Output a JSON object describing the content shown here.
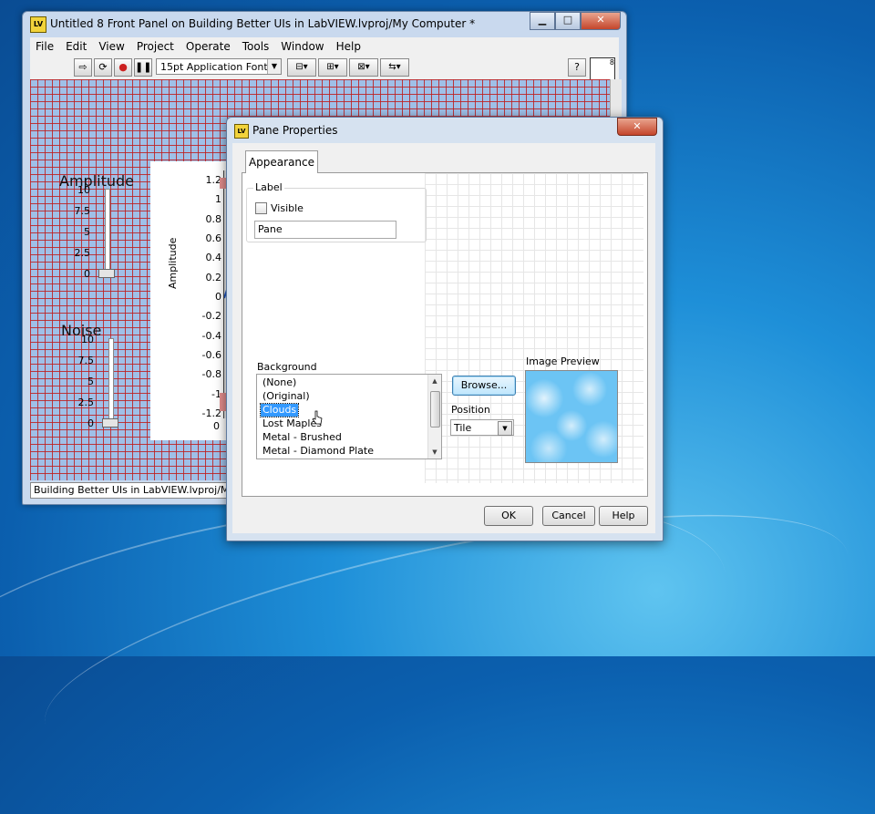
{
  "lv_window": {
    "title": "Untitled 8 Front Panel on Building Better UIs in LabVIEW.lvproj/My Computer *",
    "menu": [
      "File",
      "Edit",
      "View",
      "Project",
      "Operate",
      "Tools",
      "Window",
      "Help"
    ],
    "font_select": "15pt Application Font",
    "status_bar": "Building Better UIs in LabVIEW.lvproj/My C",
    "amplitude": {
      "label": "Amplitude",
      "scale": [
        "10",
        "7.5",
        "5",
        "2.5",
        "0"
      ]
    },
    "noise": {
      "label": "Noise",
      "scale": [
        "10",
        "7.5",
        "5",
        "2.5",
        "0"
      ]
    },
    "graph": {
      "ylabel": "Amplitude",
      "yticks": [
        "1.2",
        "1",
        "0.8",
        "0.6",
        "0.4",
        "0.2",
        "0",
        "-0.2",
        "-0.4",
        "-0.6",
        "-0.8",
        "-1",
        "-1.2"
      ],
      "xtick0": "0"
    }
  },
  "dialog": {
    "title": "Pane Properties",
    "tab": "Appearance",
    "label_group": {
      "title": "Label",
      "visible_label": "Visible",
      "visible_checked": false,
      "text_value": "Pane"
    },
    "background": {
      "title": "Background",
      "items": [
        "(None)",
        "(Original)",
        "Clouds",
        "Lost Maples",
        "Metal - Brushed",
        "Metal - Diamond Plate"
      ],
      "selected": "Clouds"
    },
    "browse_label": "Browse...",
    "position_label": "Position",
    "position_value": "Tile",
    "image_preview_label": "Image Preview",
    "buttons": {
      "ok": "OK",
      "cancel": "Cancel",
      "help": "Help"
    }
  },
  "icons": [
    "labview-icon",
    "run-arrow-icon",
    "run-continuous-icon",
    "abort-icon",
    "pause-icon",
    "align-icon",
    "distribute-icon",
    "resize-icon",
    "reorder-icon",
    "context-help-icon",
    "vi-icon",
    "close-icon",
    "minimize-icon",
    "maximize-icon",
    "mouse-pointer-icon"
  ],
  "colors": {
    "desktop": "#1e8fd8",
    "panel_grid": "#be1e1e",
    "panel_bg": "#9fc0e8",
    "selection": "#3399ff"
  }
}
